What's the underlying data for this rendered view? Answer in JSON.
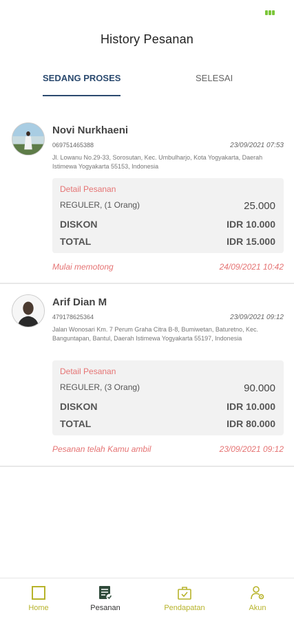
{
  "header": {
    "title": "History Pesanan"
  },
  "tabs": [
    {
      "label": "SEDANG PROSES",
      "active": true
    },
    {
      "label": "SELESAI",
      "active": false
    }
  ],
  "orders": [
    {
      "name": "Novi Nurkhaeni",
      "phone": "069751465388",
      "datetime": "23/09/2021 07:53",
      "address": "Jl. Lowanu No.29-33, Sorosutan, Kec. Umbulharjo, Kota Yogyakarta, Daerah Istimewa Yogyakarta 55153, Indonesia",
      "detail_title": "Detail Pesanan",
      "service": "REGULER, (1 Orang)",
      "service_price": "25.000",
      "discount_label": "DISKON",
      "discount_value": "IDR 10.000",
      "total_label": "TOTAL",
      "total_value": "IDR 15.000",
      "status": "Mulai memotong",
      "status_time": "24/09/2021 10:42"
    },
    {
      "name": "Arif Dian M",
      "phone": "479178625364",
      "datetime": "23/09/2021 09:12",
      "address": "Jalan Wonosari Km. 7 Perum Graha Citra B-8, Bumiwetan, Baturetno, Kec. Banguntapan, Bantul, Daerah Istimewa Yogyakarta 55197, Indonesia",
      "detail_title": "Detail Pesanan",
      "service": "REGULER, (3 Orang)",
      "service_price": "90.000",
      "discount_label": "DISKON",
      "discount_value": "IDR 10.000",
      "total_label": "TOTAL",
      "total_value": "IDR 80.000",
      "status": "Pesanan telah Kamu ambil",
      "status_time": "23/09/2021 09:12"
    }
  ],
  "bottom_nav": [
    {
      "label": "Home",
      "icon": "home-square-icon",
      "active": false
    },
    {
      "label": "Pesanan",
      "icon": "order-list-icon",
      "active": true
    },
    {
      "label": "Pendapatan",
      "icon": "briefcase-check-icon",
      "active": false
    },
    {
      "label": "Akun",
      "icon": "user-gear-icon",
      "active": false
    }
  ],
  "colors": {
    "accent": "#2b4a6f",
    "status": "#e57373",
    "nav_inactive": "#b7b32a",
    "battery": "#7cc63a"
  }
}
